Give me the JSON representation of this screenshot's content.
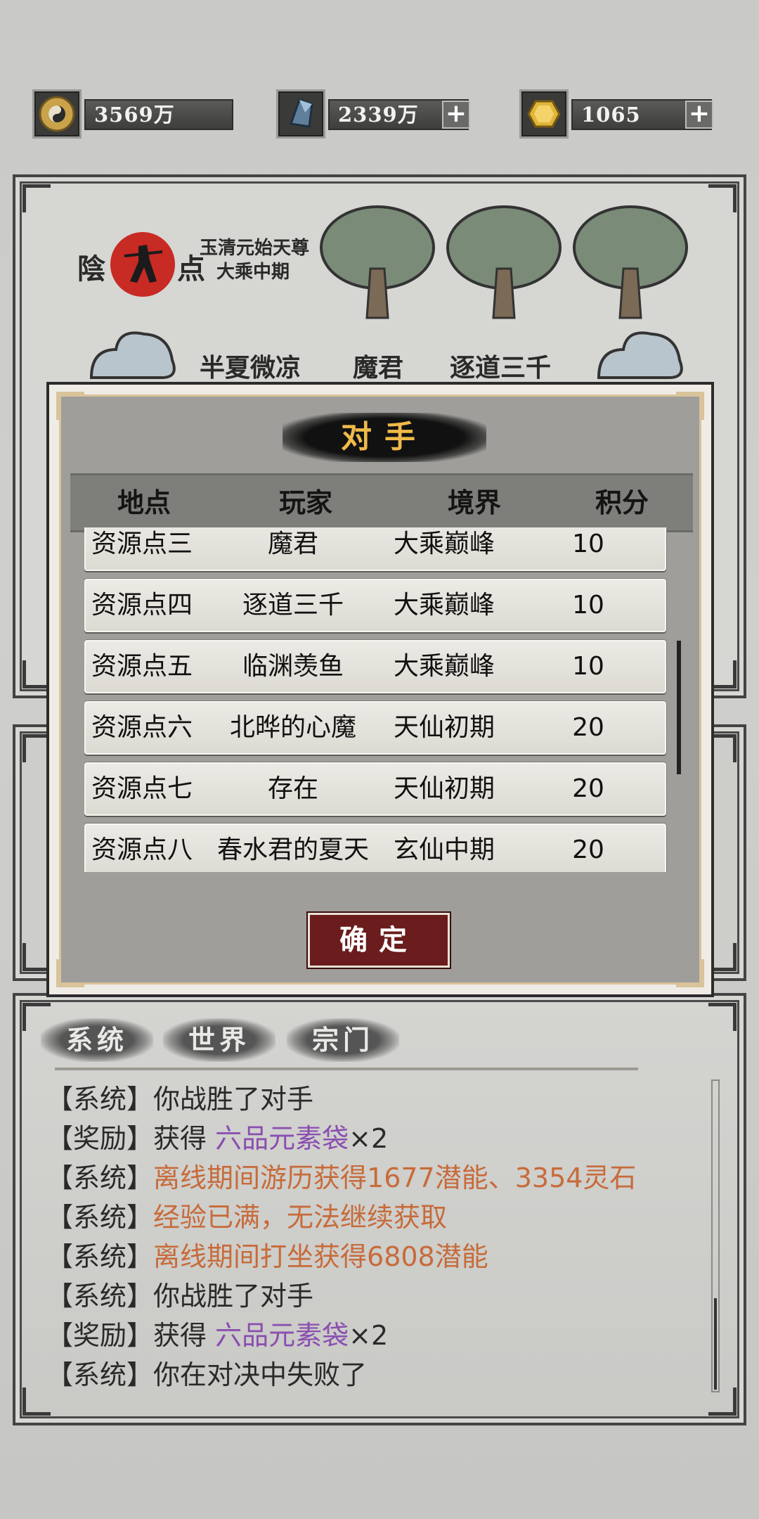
{
  "currencies": [
    {
      "icon": "taiji-coin-icon",
      "value": "3569万",
      "has_plus": false
    },
    {
      "icon": "spirit-crystal-icon",
      "value": "2339万",
      "has_plus": true
    },
    {
      "icon": "gold-gem-icon",
      "value": "1065",
      "has_plus": true
    }
  ],
  "map": {
    "player_node_label_left": "陰",
    "player_node_label_right": "点",
    "player_title_line1": "玉清元始天尊",
    "player_title_line2": "大乘中期",
    "node_names": [
      "半夏微凉",
      "魔君",
      "逐道三千"
    ]
  },
  "modal": {
    "title": "对手",
    "headers": [
      "地点",
      "玩家",
      "境界",
      "积分"
    ],
    "rows": [
      {
        "location": "资源点三",
        "player": "魔君",
        "realm": "大乘巅峰",
        "score": "10"
      },
      {
        "location": "资源点四",
        "player": "逐道三千",
        "realm": "大乘巅峰",
        "score": "10"
      },
      {
        "location": "资源点五",
        "player": "临渊羡鱼",
        "realm": "大乘巅峰",
        "score": "10"
      },
      {
        "location": "资源点六",
        "player": "北晔的心魔",
        "realm": "天仙初期",
        "score": "20"
      },
      {
        "location": "资源点七",
        "player": "存在",
        "realm": "天仙初期",
        "score": "20"
      },
      {
        "location": "资源点八",
        "player": "春水君的夏天",
        "realm": "玄仙中期",
        "score": "20"
      }
    ],
    "confirm_label": "确定"
  },
  "chat": {
    "tabs": [
      "系统",
      "世界",
      "宗门"
    ],
    "messages": [
      {
        "tag": "【系统】",
        "text": "你战胜了对手",
        "style": "normal",
        "suffix": ""
      },
      {
        "tag": "【奖励】",
        "prefix": "获得 ",
        "text": "六品元素袋",
        "style": "purple",
        "suffix": "×2"
      },
      {
        "tag": "【系统】",
        "text": "离线期间游历获得1677潜能、3354灵石",
        "style": "orange",
        "suffix": ""
      },
      {
        "tag": "【系统】",
        "text": "经验已满，无法继续获取",
        "style": "orange",
        "suffix": ""
      },
      {
        "tag": "【系统】",
        "text": "离线期间打坐获得6808潜能",
        "style": "orange",
        "suffix": ""
      },
      {
        "tag": "【系统】",
        "text": "你战胜了对手",
        "style": "normal",
        "suffix": ""
      },
      {
        "tag": "【奖励】",
        "prefix": "获得 ",
        "text": "六品元素袋",
        "style": "purple",
        "suffix": "×2"
      },
      {
        "tag": "【系统】",
        "text": "你在对决中失败了",
        "style": "normal",
        "suffix": ""
      }
    ]
  },
  "colors": {
    "accent_orange": "#c76b3a",
    "accent_purple": "#8a4fb0",
    "confirm_red": "#6b1c1c",
    "title_gold": "#f0b94a"
  }
}
